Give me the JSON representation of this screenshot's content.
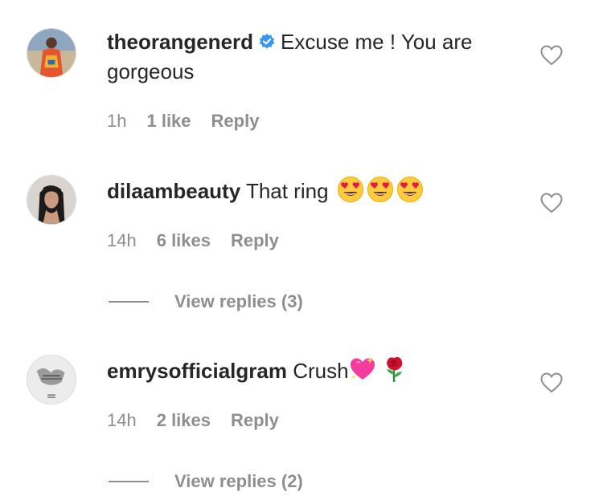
{
  "comments": [
    {
      "username": "theorangenerd",
      "verified": true,
      "text": "Excuse me ! You are gorgeous",
      "time": "1h",
      "likes": "1 like",
      "reply_label": "Reply",
      "avatar_icon": "avatar-man-colorful-outfit"
    },
    {
      "username": "dilaambeauty",
      "verified": false,
      "text": "That ring",
      "emojis": [
        "heart-eyes-emoji",
        "heart-eyes-emoji",
        "heart-eyes-emoji"
      ],
      "time": "14h",
      "likes": "6 likes",
      "reply_label": "Reply",
      "view_replies": "View replies (3)",
      "avatar_icon": "avatar-woman-dark-hair"
    },
    {
      "username": "emrysofficialgram",
      "verified": false,
      "text": "Crush",
      "emojis": [
        "sparkling-heart-emoji",
        "rose-emoji"
      ],
      "time": "14h",
      "likes": "2 likes",
      "reply_label": "Reply",
      "view_replies": "View replies (2)",
      "avatar_icon": "avatar-gray-sketch"
    }
  ],
  "colors": {
    "text": "#262626",
    "secondary": "#8e8e8e",
    "verified": "#3897f0"
  }
}
